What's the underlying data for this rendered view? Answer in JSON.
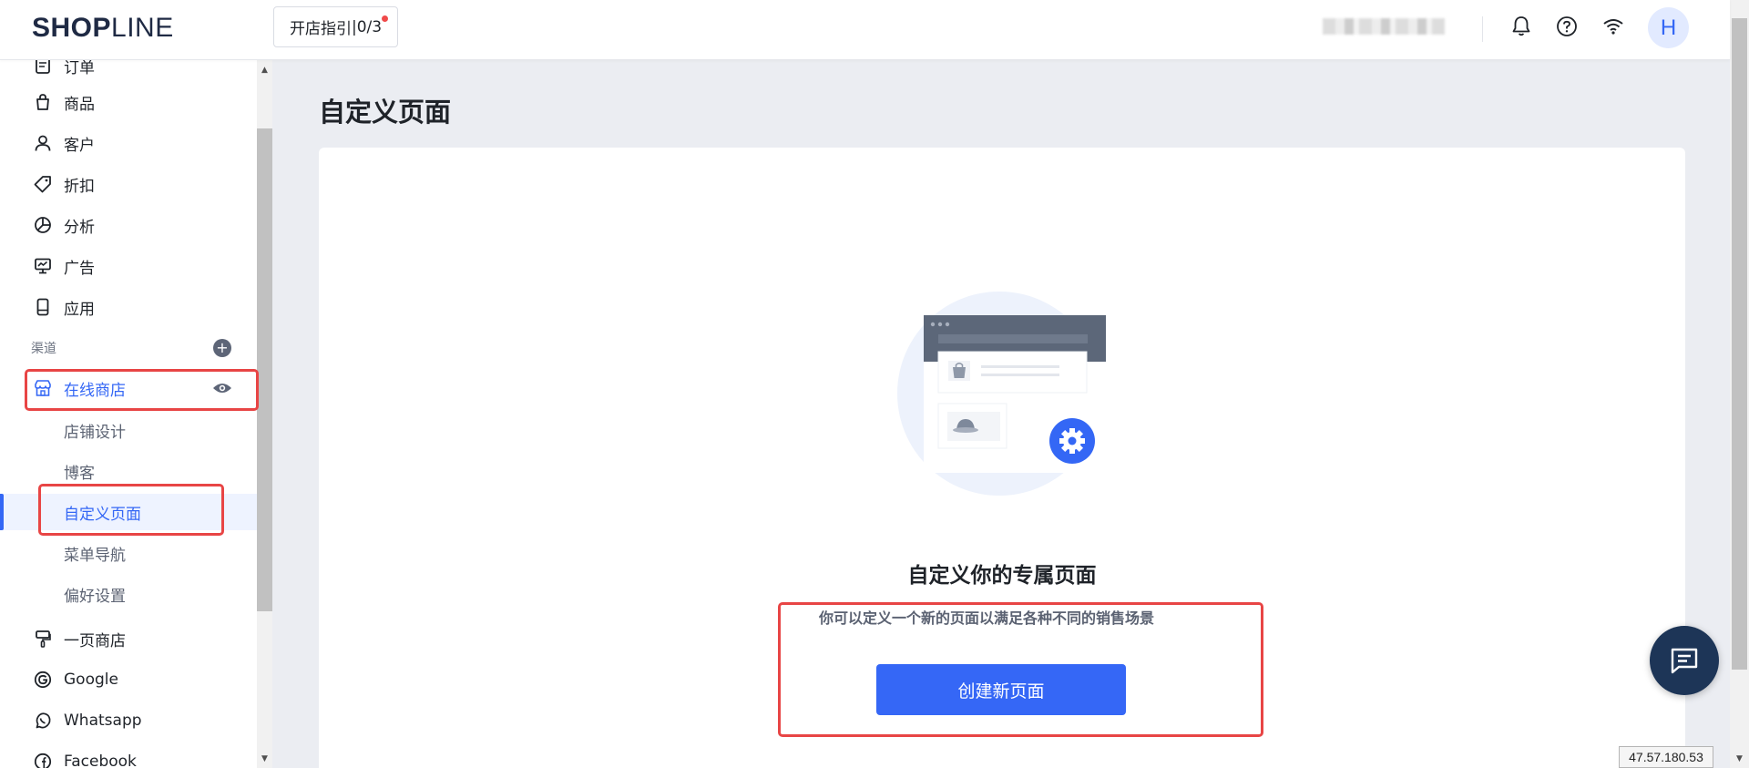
{
  "header": {
    "logo_bold": "SHOP",
    "logo_light": "LINE",
    "guide_label": "开店指引",
    "guide_progress": "0/3",
    "avatar_initial": "H"
  },
  "sidebar": {
    "items_top": [
      {
        "label": "订单",
        "icon": "order-icon"
      },
      {
        "label": "商品",
        "icon": "bag-icon"
      },
      {
        "label": "客户",
        "icon": "user-icon"
      },
      {
        "label": "折扣",
        "icon": "tag-icon"
      },
      {
        "label": "分析",
        "icon": "pie-chart-icon"
      },
      {
        "label": "广告",
        "icon": "monitor-icon"
      },
      {
        "label": "应用",
        "icon": "device-icon"
      }
    ],
    "section_label": "渠道",
    "online_store": "在线商店",
    "sub_items": [
      {
        "label": "店铺设计"
      },
      {
        "label": "博客"
      },
      {
        "label": "自定义页面"
      },
      {
        "label": "菜单导航"
      },
      {
        "label": "偏好设置"
      }
    ],
    "items_bottom": [
      {
        "label": "一页商店",
        "icon": "brush-icon"
      },
      {
        "label": "Google",
        "icon": "google-icon"
      },
      {
        "label": "Whatsapp",
        "icon": "whatsapp-icon"
      },
      {
        "label": "Facebook",
        "icon": "facebook-icon"
      }
    ]
  },
  "main": {
    "page_title": "自定义页面",
    "empty_title": "自定义你的专属页面",
    "empty_desc": "你可以定义一个新的页面以满足各种不同的销售场景",
    "create_button": "创建新页面"
  },
  "ip_address": "47.57.180.53",
  "colors": {
    "accent": "#3467f5",
    "highlight": "#e84545",
    "chat_fab": "#1d3557"
  }
}
